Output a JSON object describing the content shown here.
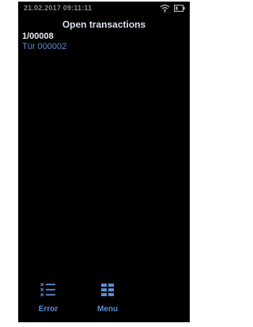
{
  "status_bar": {
    "datetime": "21.02.2017 09:11:11"
  },
  "header": {
    "title": "Open transactions"
  },
  "transactions": [
    {
      "number": "1/00008",
      "location": "Tür 000002"
    }
  ],
  "bottom_bar": {
    "error_label": "Error",
    "menu_label": "Menu"
  },
  "colors": {
    "background": "#000000",
    "accent": "#5b8fd1",
    "title": "#d6e0ee"
  },
  "icons": {
    "wifi": "wifi-icon",
    "battery": "battery-icon",
    "error": "error-list-icon",
    "menu": "grid-menu-icon"
  }
}
